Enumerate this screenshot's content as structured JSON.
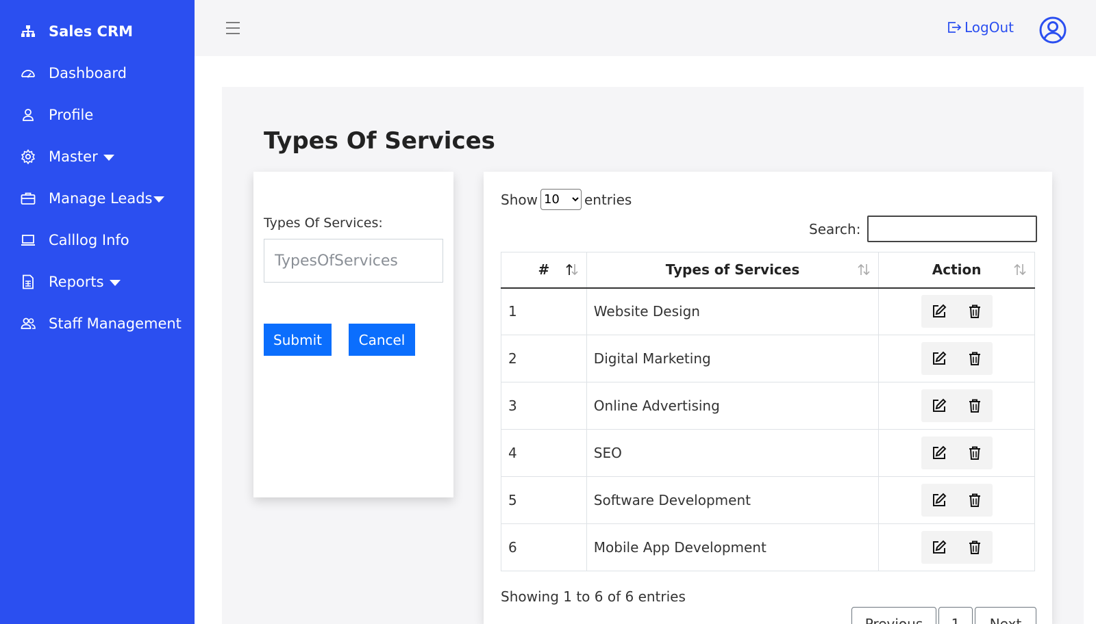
{
  "sidebar": {
    "brand": "Sales CRM",
    "items": [
      {
        "label": "Dashboard",
        "icon": "gauge-icon",
        "caret": false
      },
      {
        "label": "Profile",
        "icon": "user-icon",
        "caret": false
      },
      {
        "label": "Master",
        "icon": "gear-icon",
        "caret": true
      },
      {
        "label": "Manage Leads",
        "icon": "briefcase-icon",
        "caret": true
      },
      {
        "label": "Calllog Info",
        "icon": "laptop-icon",
        "caret": false
      },
      {
        "label": "Reports",
        "icon": "report-icon",
        "caret": true
      },
      {
        "label": "Staff Management",
        "icon": "users-icon",
        "caret": false
      }
    ]
  },
  "topbar": {
    "logout_label": "LogOut"
  },
  "page": {
    "title": "Types Of Services"
  },
  "form": {
    "label": "Types Of Services:",
    "placeholder": "TypesOfServices",
    "value": "",
    "submit_label": "Submit",
    "cancel_label": "Cancel"
  },
  "table": {
    "show_label": "Show",
    "entries_label": "entries",
    "page_length": "10",
    "search_label": "Search:",
    "search_value": "",
    "columns": [
      "#",
      "Types of Services",
      "Action"
    ],
    "rows": [
      {
        "num": "1",
        "service": "Website Design"
      },
      {
        "num": "2",
        "service": "Digital Marketing"
      },
      {
        "num": "3",
        "service": "Online Advertising"
      },
      {
        "num": "4",
        "service": "SEO"
      },
      {
        "num": "5",
        "service": "Software Development"
      },
      {
        "num": "6",
        "service": "Mobile App Development"
      }
    ],
    "info": "Showing 1 to 6 of 6 entries",
    "pagination": {
      "previous": "Previous",
      "current_page": "1",
      "next": "Next"
    }
  },
  "colors": {
    "sidebar_bg": "#2b4ff0",
    "primary_button": "#0b6efd",
    "topbar_bg": "#f5f5f7"
  }
}
